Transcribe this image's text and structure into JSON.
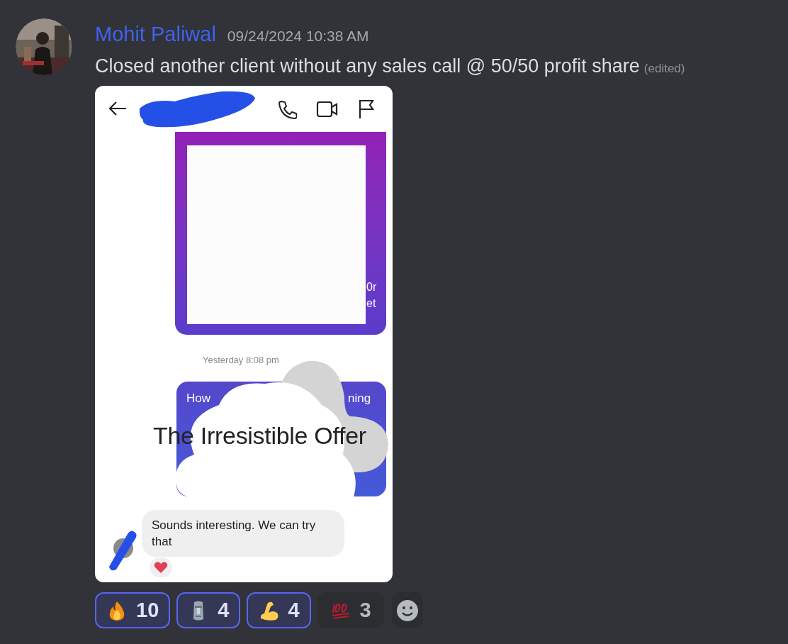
{
  "message": {
    "author": "Mohit Paliwal",
    "timestamp": "09/24/2024 10:38 AM",
    "text": "Closed another client without any sales call @ 50/50 profit share",
    "edited": "(edited)"
  },
  "attachment": {
    "fragments": [
      "0r",
      "et"
    ],
    "timestamp": "Yesterday 8:08 pm",
    "card_left": "How",
    "card_right": "ning",
    "overlay_title": "The Irresistible Offer",
    "reply": "Sounds interesting. We can try that"
  },
  "reactions": [
    {
      "kind": "fire",
      "count": "10",
      "selected": true
    },
    {
      "kind": "moai",
      "count": "4",
      "selected": true
    },
    {
      "kind": "muscle",
      "count": "4",
      "selected": true
    },
    {
      "kind": "hundred",
      "count": "3",
      "selected": false
    }
  ]
}
